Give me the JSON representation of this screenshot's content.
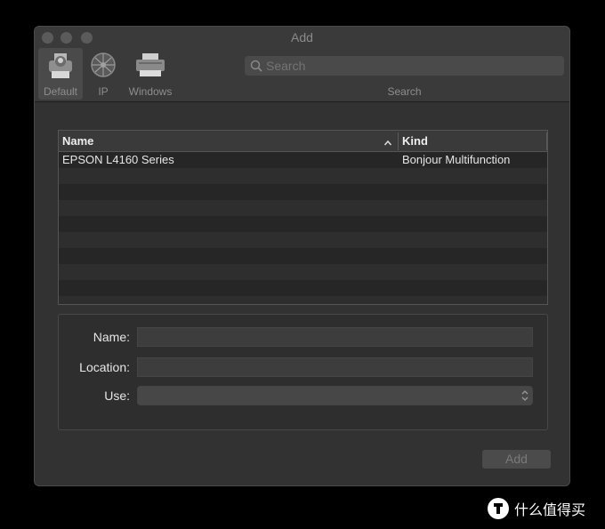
{
  "window": {
    "title": "Add"
  },
  "toolbar": {
    "items": [
      {
        "label": "Default",
        "icon": "printer-default-icon",
        "selected": true
      },
      {
        "label": "IP",
        "icon": "ip-globe-icon",
        "selected": false
      },
      {
        "label": "Windows",
        "icon": "windows-printer-icon",
        "selected": false
      }
    ],
    "search": {
      "placeholder": "Search",
      "value": "",
      "caption": "Search"
    }
  },
  "table": {
    "columns": [
      {
        "label": "Name",
        "sort": "ascending",
        "sort_icon": "chevron-up-icon"
      },
      {
        "label": "Kind"
      }
    ],
    "rows": [
      {
        "name": "EPSON L4160 Series",
        "kind": "Bonjour Multifunction"
      }
    ]
  },
  "form": {
    "name_label": "Name:",
    "name_value": "",
    "location_label": "Location:",
    "location_value": "",
    "use_label": "Use:",
    "use_value": ""
  },
  "add_button": {
    "label": "Add"
  },
  "watermark": {
    "text": "什么值得买"
  },
  "colors": {
    "window_bg": "#323232",
    "toolbar_bg": "#3a3a3a",
    "row_dark": "#262626",
    "row_light": "#2e2e2e"
  }
}
